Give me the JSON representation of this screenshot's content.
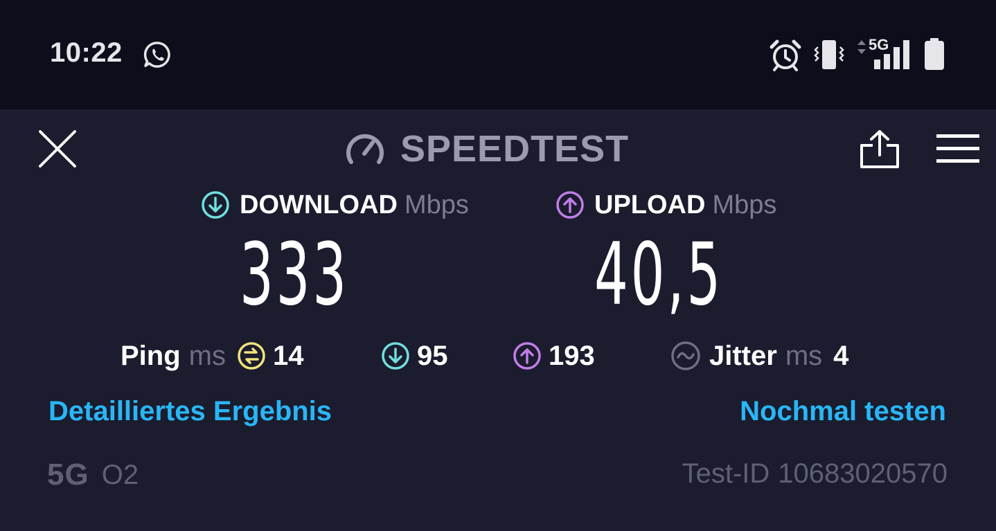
{
  "status_bar": {
    "time": "10:22",
    "network": "5G",
    "icons": [
      "whatsapp-icon",
      "alarm-icon",
      "vibrate-icon",
      "signal-icon",
      "battery-icon"
    ]
  },
  "header": {
    "logo_text": "SPEEDTEST",
    "icons": [
      "close-icon",
      "speedometer-icon",
      "share-icon",
      "menu-icon"
    ]
  },
  "download": {
    "label": "DOWNLOAD",
    "unit": "Mbps",
    "value": "333",
    "color": "#6fe0e0"
  },
  "upload": {
    "label": "UPLOAD",
    "unit": "Mbps",
    "value": "40,5",
    "color": "#c07ee8"
  },
  "ping": {
    "label": "Ping",
    "unit": "ms",
    "idle": "14",
    "download": "95",
    "upload": "193",
    "idle_color": "#f2e27a"
  },
  "jitter": {
    "label": "Jitter",
    "unit": "ms",
    "value": "4"
  },
  "actions": {
    "details": "Detailliertes Ergebnis",
    "retest": "Nochmal testen"
  },
  "footer": {
    "network_type": "5G",
    "carrier": "O2",
    "test_id_label": "Test-ID",
    "test_id": "10683020570"
  },
  "colors": {
    "background": "#1b1c2e",
    "status_bar": "#0d0e1b",
    "link": "#29b6f6",
    "muted": "#5f6074"
  }
}
